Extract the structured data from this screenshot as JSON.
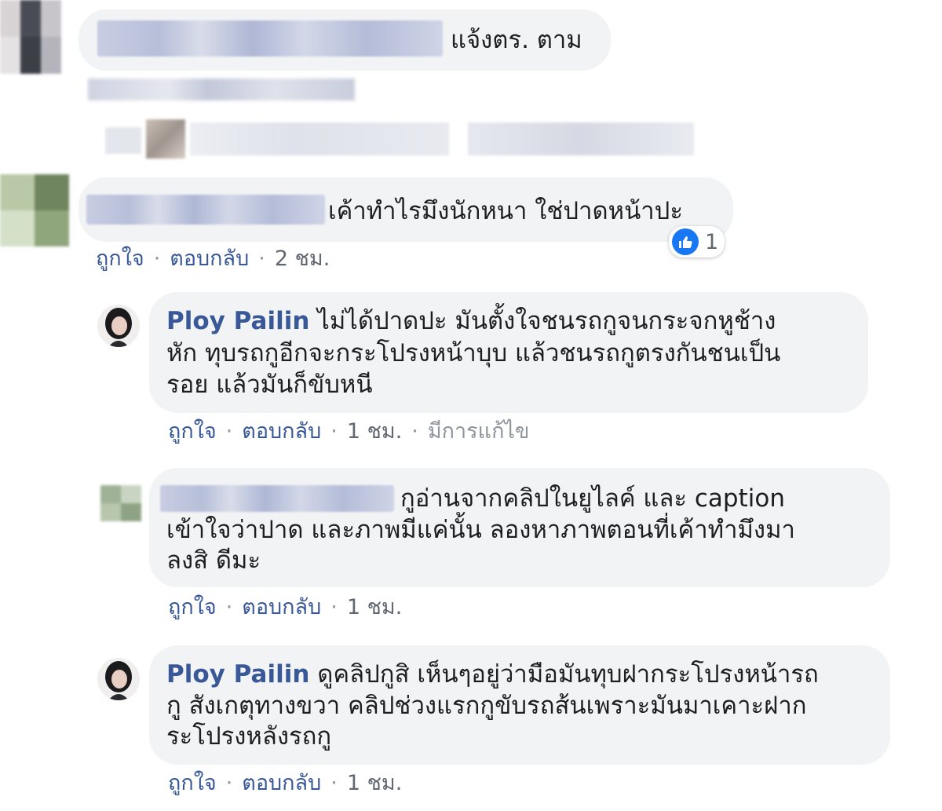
{
  "comments": [
    {
      "author": "",
      "text": "แจ้งตร. ตาม",
      "meta": {
        "like": "ถูกใจ",
        "reply": "ตอบกลับ",
        "time": "2 ชม."
      }
    },
    {
      "author": "",
      "text": "เค้าทำไรมึงนักหนา ใช่ปาดหน้าปะ",
      "reaction": {
        "icon": "like-icon",
        "count": "1"
      },
      "meta": {
        "like": "ถูกใจ",
        "reply": "ตอบกลับ",
        "time": "2 ชม."
      }
    }
  ],
  "replies": [
    {
      "author": "Ploy Pailin",
      "lines": [
        "ไม่ได้ปาดปะ มันตั้งใจชนรถกูจนกระจกหูช้าง",
        "หัก ทุบรถกูอีกจะกระโปรงหน้าบุบ แล้วชนรถกูตรงกันชนเป็น",
        "รอย แล้วมันก็ขับหนี"
      ],
      "meta": {
        "like": "ถูกใจ",
        "reply": "ตอบกลับ",
        "time": "1 ชม.",
        "edited": "มีการแก้ไข"
      }
    },
    {
      "author": "",
      "lines": [
        "กูอ่านจากคลิปในยูไลค์ และ caption",
        "เข้าใจว่าปาด และภาพมีแค่นั้น ลองหาภาพตอนที่เค้าทำมึงมา",
        "ลงสิ ดีมะ"
      ],
      "meta": {
        "like": "ถูกใจ",
        "reply": "ตอบกลับ",
        "time": "1 ชม."
      }
    },
    {
      "author": "Ploy Pailin",
      "lines": [
        "ดูคลิปกูสิ เห็นๆอยู่ว่ามือมันทุบฝากระโปรงหน้ารถ",
        "กู สังเกตุทางขวา คลิปช่วงแรกกูขับรถส้นเพราะมันมาเคาะฝาก",
        "ระโปรงหลังรถกู"
      ],
      "meta": {
        "like": "ถูกใจ",
        "reply": "ตอบกลับ",
        "time": "1 ชม."
      }
    }
  ],
  "colors": {
    "author": "#385898",
    "bubble": "#f2f3f5",
    "like": "#1877f2",
    "meta": "#606770"
  }
}
